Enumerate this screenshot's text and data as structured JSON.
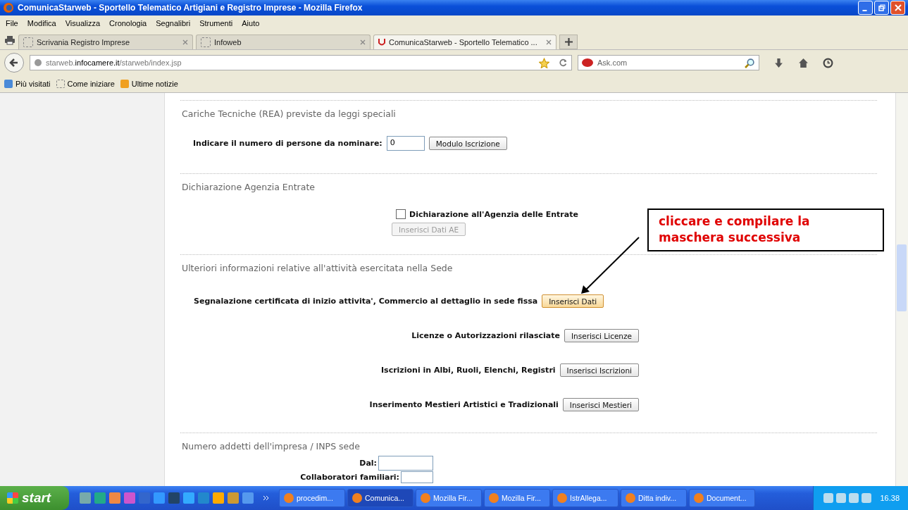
{
  "window": {
    "title": "ComunicaStarweb - Sportello Telematico Artigiani e Registro Imprese - Mozilla Firefox"
  },
  "menu": [
    "File",
    "Modifica",
    "Visualizza",
    "Cronologia",
    "Segnalibri",
    "Strumenti",
    "Aiuto"
  ],
  "tabs": [
    {
      "label": "Scrivania Registro Imprese",
      "selected": false
    },
    {
      "label": "Infoweb",
      "selected": false
    },
    {
      "label": "ComunicaStarweb - Sportello Telematico ...",
      "selected": true
    }
  ],
  "address": {
    "host_pre": "starweb.",
    "host": "infocamere.it",
    "path": "/starweb/index.jsp"
  },
  "search": {
    "placeholder": "Ask.com"
  },
  "bookmarks": [
    "Più visitati",
    "Come iniziare",
    "Ultime notizie"
  ],
  "sections": [
    {
      "title": "Cariche Tecniche (REA) previste da leggi speciali",
      "rows": [
        {
          "kind": "input",
          "label": "Indicare il numero di persone da nominare:",
          "value": "0",
          "button": "Modulo Iscrizione"
        }
      ]
    },
    {
      "title": "Dichiarazione Agenzia Entrate",
      "rows": [
        {
          "kind": "checkbox",
          "label": "Dichiarazione all'Agenzia delle Entrate",
          "checked": false,
          "button": "Inserisci Dati AE",
          "disabled": true
        }
      ]
    },
    {
      "title": "Ulteriori informazioni relative all'attività esercitata nella Sede",
      "rows": [
        {
          "kind": "button",
          "label": "Segnalazione certificata di inizio attivita', Commercio al dettaglio in sede fissa",
          "button": "Inserisci Dati",
          "highlighted": true
        },
        {
          "kind": "button",
          "label": "Licenze o Autorizzazioni rilasciate",
          "button": "Inserisci Licenze",
          "highlighted": false
        },
        {
          "kind": "button",
          "label": "Iscrizioni in Albi, Ruoli, Elenchi, Registri",
          "button": "Inserisci Iscrizioni",
          "highlighted": false
        },
        {
          "kind": "button",
          "label": "Inserimento Mestieri Artistici e Tradizionali",
          "button": "Inserisci Mestieri",
          "highlighted": false
        }
      ]
    },
    {
      "title": "Numero addetti dell'impresa / INPS sede",
      "rows": [
        {
          "kind": "field",
          "label": "Dal:"
        },
        {
          "kind": "field",
          "label": "Collaboratori familiari:"
        }
      ]
    }
  ],
  "callout": {
    "text": "cliccare e compilare la maschera successiva"
  },
  "taskbar": {
    "start": "start",
    "items": [
      "procedim...",
      "Comunica...",
      "Mozilla Fir...",
      "Mozilla Fir...",
      "IstrAllega...",
      "Ditta indiv...",
      "Document..."
    ],
    "clock": "16.38"
  }
}
